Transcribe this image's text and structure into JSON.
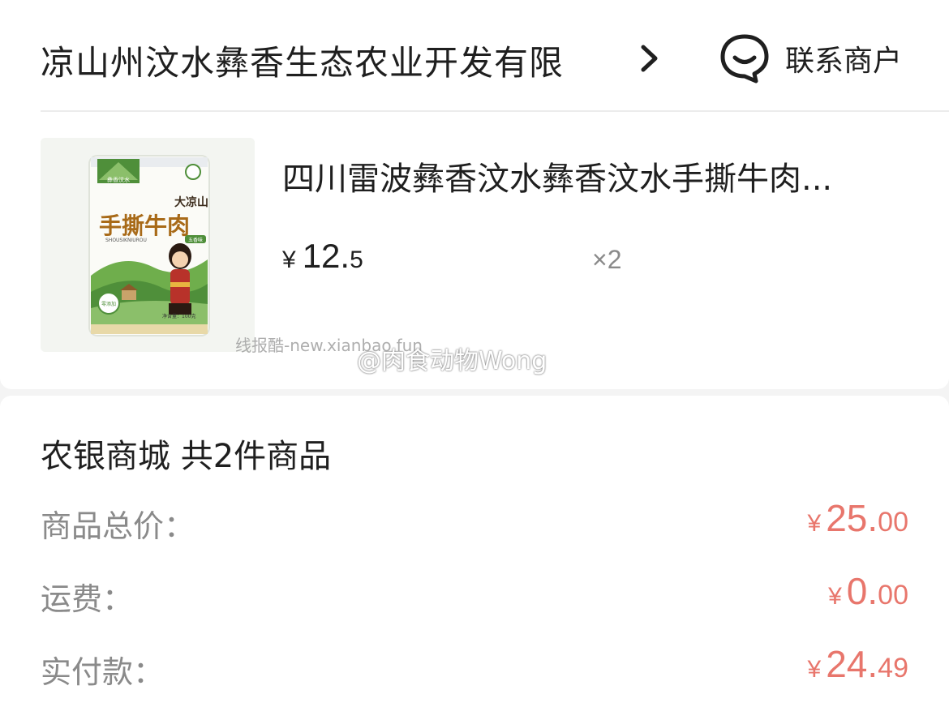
{
  "shop": {
    "name": "凉山州汶水彝香生态农业开发有限",
    "contact_label": "联系商户"
  },
  "product": {
    "title": "四川雷波彝香汶水彝香汶水手撕牛肉...",
    "price_currency": "¥",
    "price_int": "12.",
    "price_dec": "5",
    "quantity": "×2",
    "image_text": {
      "brand": "彝香汶水",
      "region": "大凉山",
      "name": "手撕牛肉",
      "pinyin": "SHOUSIKNIUROU",
      "flavor": "五香味",
      "badge": "零添加",
      "weight": "净含量：100克"
    }
  },
  "watermarks": {
    "site": "线报酷-new.xianbao.fun",
    "user": "@肉食动物Wong"
  },
  "summary": {
    "title": "农银商城 共2件商品",
    "rows": [
      {
        "label": "商品总价：",
        "currency": "¥",
        "int": "25.",
        "dec": "00"
      },
      {
        "label": "运费：",
        "currency": "¥",
        "int": "0.",
        "dec": "00"
      },
      {
        "label": "实付款：",
        "currency": "¥",
        "int": "24.",
        "dec": "49"
      }
    ]
  },
  "colors": {
    "accent_price": "#e8766c",
    "text_primary": "#1f1f1f",
    "text_secondary": "#8a8a8a",
    "package_green": "#4f8f3a"
  }
}
